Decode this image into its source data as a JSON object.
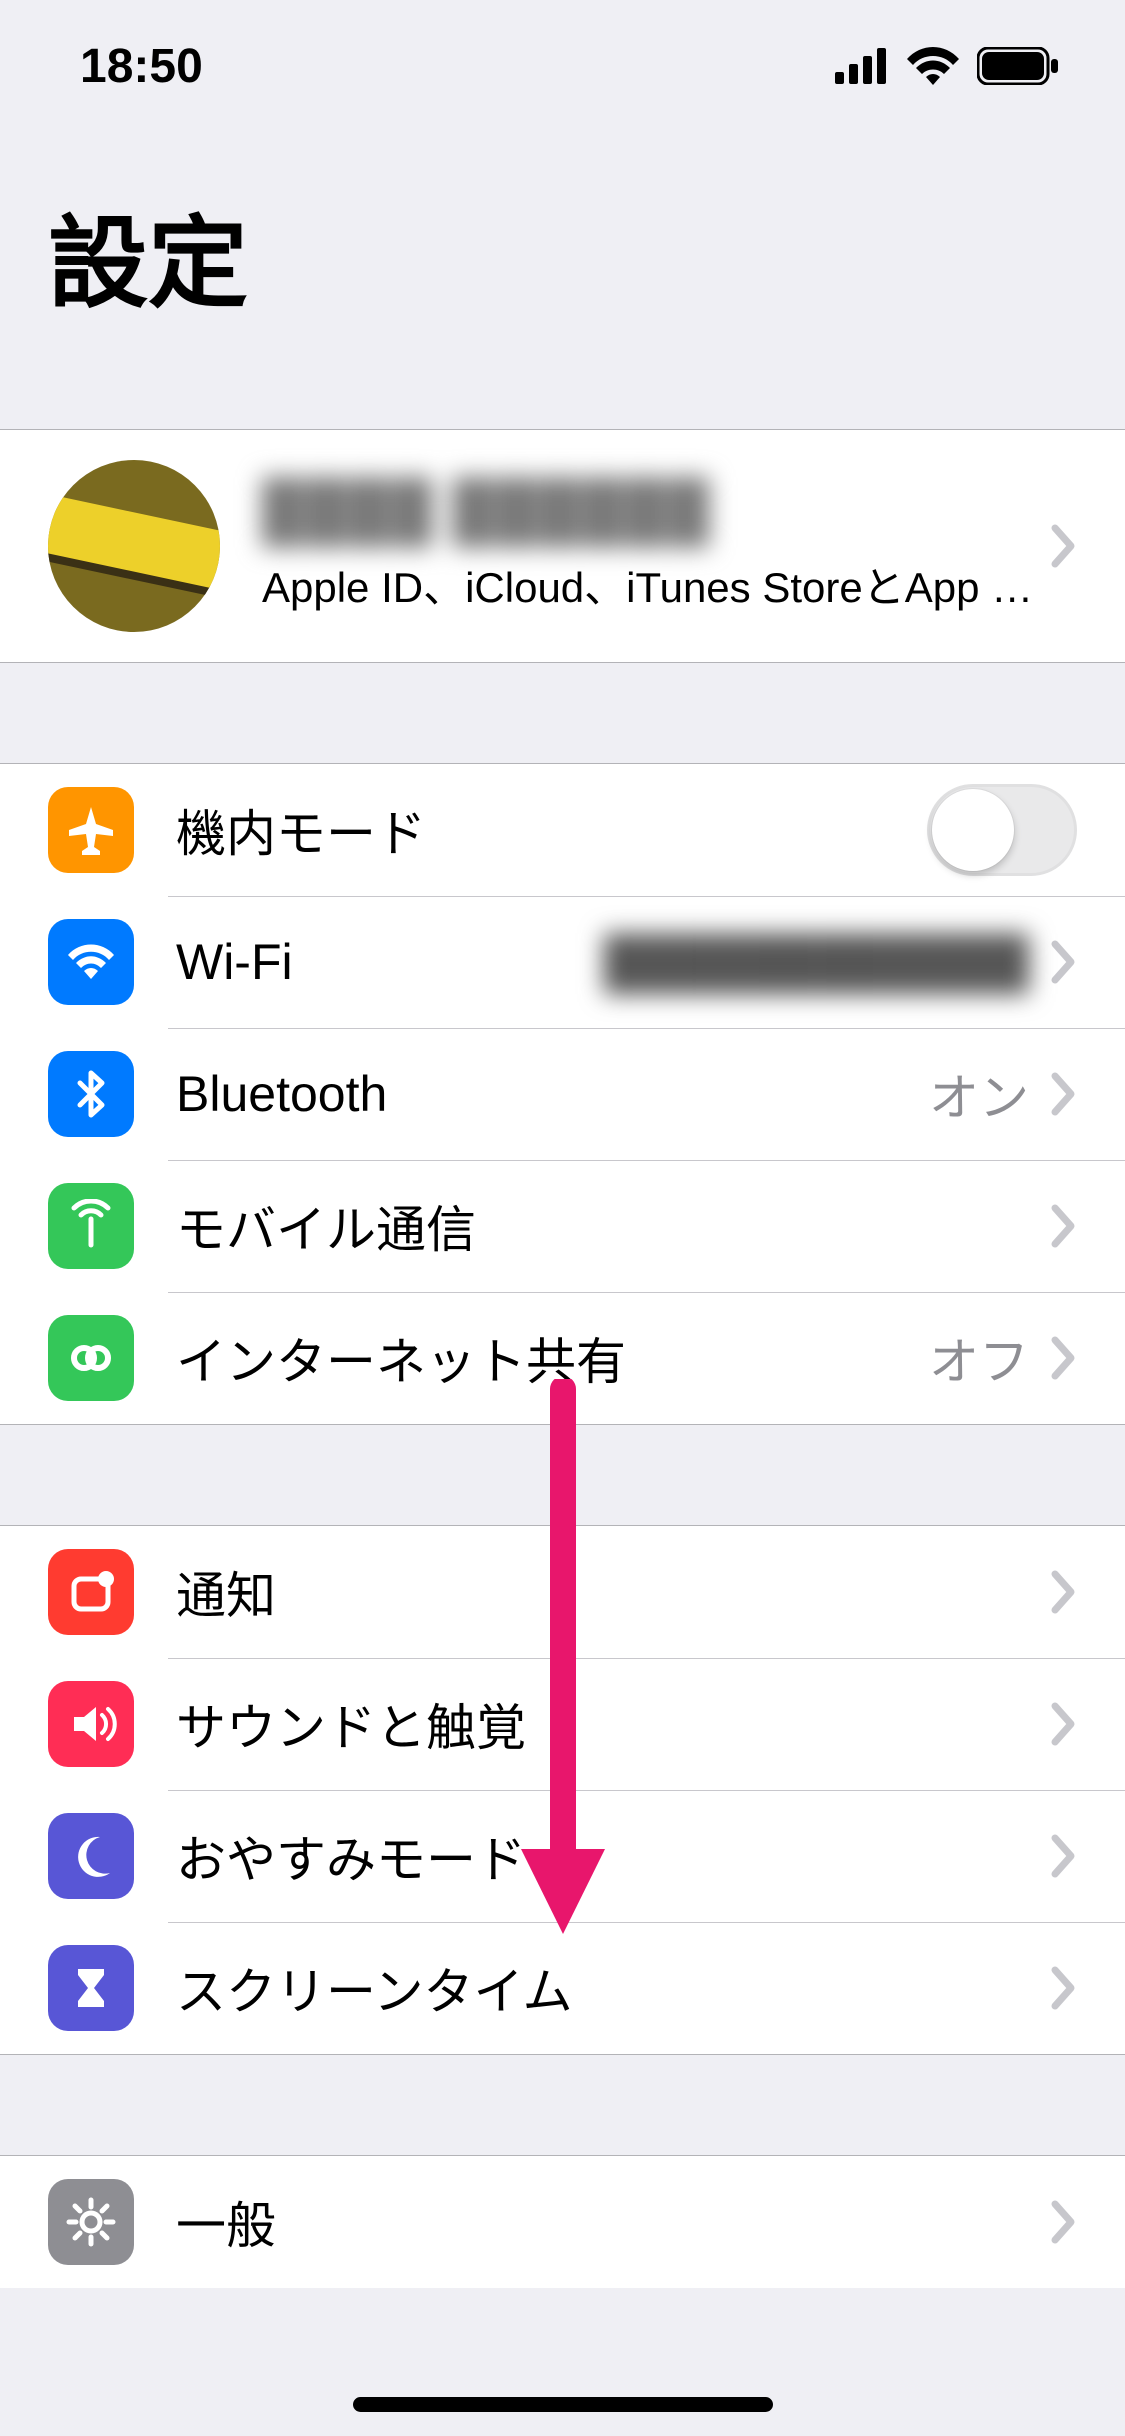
{
  "status": {
    "time": "18:50"
  },
  "title": "設定",
  "apple_id": {
    "name": "████ ██████",
    "subtitle": "Apple ID、iCloud、iTunes StoreとApp S…"
  },
  "group1": {
    "airplane": {
      "label": "機内モード"
    },
    "wifi": {
      "label": "Wi-Fi",
      "value": "████████████"
    },
    "bluetooth": {
      "label": "Bluetooth",
      "value": "オン"
    },
    "cellular": {
      "label": "モバイル通信"
    },
    "hotspot": {
      "label": "インターネット共有",
      "value": "オフ"
    }
  },
  "group2": {
    "notifications": {
      "label": "通知"
    },
    "sounds": {
      "label": "サウンドと触覚"
    },
    "dnd": {
      "label": "おやすみモード"
    },
    "screentime": {
      "label": "スクリーンタイム"
    }
  },
  "group3": {
    "general": {
      "label": "一般"
    }
  }
}
